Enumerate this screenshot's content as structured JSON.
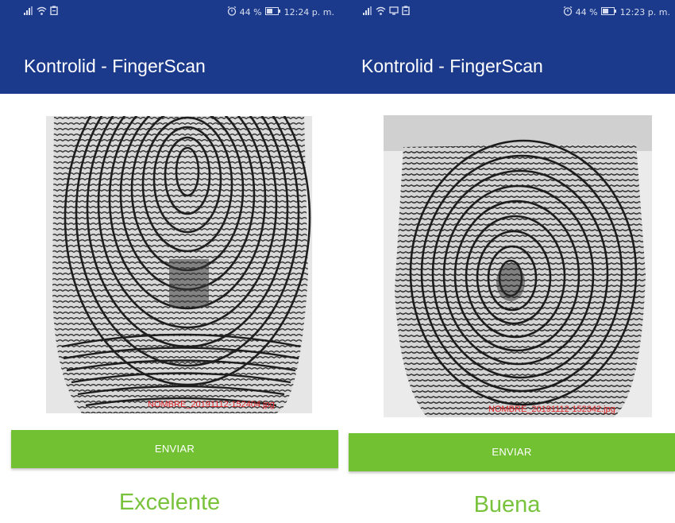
{
  "screens": [
    {
      "status": {
        "left_icons": [
          "signal-icon",
          "wifi-icon",
          "clipboard-icon"
        ],
        "alarm": "alarm-icon",
        "battery_text": "44 %",
        "time": "12:24 p. m."
      },
      "app_title": "Kontrolid - FingerScan",
      "fingerprint": {
        "image": "fingerprint-image",
        "filename": "NOMBRE_20191112-152404.jpg"
      },
      "button_label": "ENVIAR",
      "quality": "Excelente"
    },
    {
      "status": {
        "left_icons": [
          "signal-icon",
          "wifi-icon",
          "cast-icon",
          "clipboard-icon"
        ],
        "alarm": "alarm-icon",
        "battery_text": "44 %",
        "time": "12:23 p. m."
      },
      "app_title": "Kontrolid - FingerScan",
      "fingerprint": {
        "image": "fingerprint-image",
        "filename": "NOMBRE_20191112-152342.jpg"
      },
      "button_label": "ENVIAR",
      "quality": "Buena"
    }
  ],
  "colors": {
    "app_bar": "#1c3a8c",
    "button": "#72c133",
    "quality_text": "#78c23c",
    "filename_text": "#e0242a"
  }
}
